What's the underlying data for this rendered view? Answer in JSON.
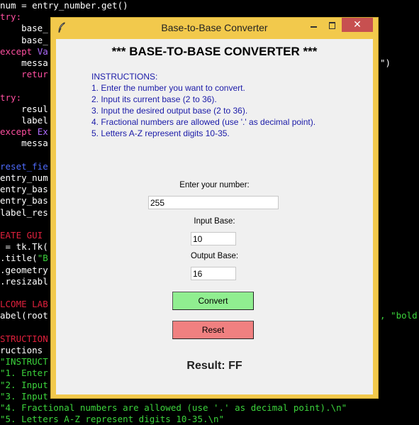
{
  "editor": {
    "lines": [
      {
        "segments": [
          {
            "text": "num = entry_number.get()",
            "color": "#ffffff"
          }
        ]
      },
      {
        "segments": [
          {
            "text": "try:",
            "color": "#ff4fa0"
          }
        ]
      },
      {
        "segments": [
          {
            "text": "    base_",
            "color": "#ffffff"
          }
        ]
      },
      {
        "segments": [
          {
            "text": "    base_",
            "color": "#ffffff"
          }
        ]
      },
      {
        "segments": [
          {
            "text": "except ",
            "color": "#ff4fa0"
          },
          {
            "text": "Va",
            "color": "#b06cff"
          }
        ]
      },
      {
        "segments": [
          {
            "text": "    messa",
            "color": "#ffffff"
          }
        ]
      },
      {
        "segments": [
          {
            "text": "    retur",
            "color": "#ff4fa0"
          }
        ]
      },
      {
        "segments": [
          {
            "text": "",
            "color": "#ffffff"
          }
        ]
      },
      {
        "segments": [
          {
            "text": "try:",
            "color": "#ff4fa0"
          }
        ]
      },
      {
        "segments": [
          {
            "text": "    resul",
            "color": "#ffffff"
          }
        ]
      },
      {
        "segments": [
          {
            "text": "    label",
            "color": "#ffffff"
          }
        ]
      },
      {
        "segments": [
          {
            "text": "except ",
            "color": "#ff4fa0"
          },
          {
            "text": "Ex",
            "color": "#b06cff"
          }
        ]
      },
      {
        "segments": [
          {
            "text": "    messa",
            "color": "#ffffff"
          }
        ]
      },
      {
        "segments": [
          {
            "text": "",
            "color": "#ffffff"
          }
        ]
      },
      {
        "segments": [
          {
            "text": "reset_fie",
            "color": "#4f6cff"
          }
        ]
      },
      {
        "segments": [
          {
            "text": "entry_num",
            "color": "#ffffff"
          }
        ]
      },
      {
        "segments": [
          {
            "text": "entry_bas",
            "color": "#ffffff"
          }
        ]
      },
      {
        "segments": [
          {
            "text": "entry_bas",
            "color": "#ffffff"
          }
        ]
      },
      {
        "segments": [
          {
            "text": "label_res",
            "color": "#ffffff"
          }
        ]
      },
      {
        "segments": [
          {
            "text": "",
            "color": "#ffffff"
          }
        ]
      },
      {
        "segments": [
          {
            "text": "EATE GUI",
            "color": "#e0203c"
          }
        ]
      },
      {
        "segments": [
          {
            "text": " = tk.Tk(",
            "color": "#ffffff"
          }
        ]
      },
      {
        "segments": [
          {
            "text": ".title(",
            "color": "#ffffff"
          },
          {
            "text": "\"B",
            "color": "#3cd43c"
          }
        ]
      },
      {
        "segments": [
          {
            "text": ".geometry",
            "color": "#ffffff"
          }
        ]
      },
      {
        "segments": [
          {
            "text": ".resizabl",
            "color": "#ffffff"
          }
        ]
      },
      {
        "segments": [
          {
            "text": "",
            "color": "#ffffff"
          }
        ]
      },
      {
        "segments": [
          {
            "text": "LCOME LAB",
            "color": "#e0203c"
          }
        ]
      },
      {
        "segments": [
          {
            "text": "abel(root",
            "color": "#ffffff"
          }
        ]
      },
      {
        "segments": [
          {
            "text": "",
            "color": "#ffffff"
          }
        ]
      },
      {
        "segments": [
          {
            "text": "STRUCTION",
            "color": "#e0203c"
          }
        ]
      },
      {
        "segments": [
          {
            "text": "ructions",
            "color": "#ffffff"
          }
        ]
      },
      {
        "segments": [
          {
            "text": "\"INSTRUCT",
            "color": "#3cd43c"
          }
        ]
      },
      {
        "segments": [
          {
            "text": "\"1. Enter",
            "color": "#3cd43c"
          }
        ]
      },
      {
        "segments": [
          {
            "text": "\"2. Input",
            "color": "#3cd43c"
          }
        ]
      },
      {
        "segments": [
          {
            "text": "\"3. Input",
            "color": "#3cd43c"
          }
        ]
      },
      {
        "segments": [
          {
            "text": "\"4. Fractional numbers are allowed (use '.' as decimal point).\\n\"",
            "color": "#3cd43c"
          }
        ]
      },
      {
        "segments": [
          {
            "text": "\"5. Letters A-Z represent digits 10-35.\\n\"",
            "color": "#3cd43c"
          }
        ]
      }
    ],
    "right_fragments": [
      {
        "line": 5,
        "text": "\")",
        "color": "#ffffff"
      },
      {
        "line": 27,
        "text": ", \"bold",
        "color": "#3cd43c"
      }
    ]
  },
  "window": {
    "title": "Base-to-Base Converter",
    "close_glyph": "✕"
  },
  "app": {
    "heading": "*** BASE-TO-BASE CONVERTER ***",
    "instructions": [
      "INSTRUCTIONS:",
      "1. Enter the number you want to convert.",
      "2. Input its current base (2 to 36).",
      "3. Input the desired output base (2 to 36).",
      "4. Fractional numbers are allowed (use '.' as decimal point).",
      "5. Letters A-Z represent digits 10-35."
    ],
    "number_label": "Enter your number:",
    "number_value": "255",
    "input_base_label": "Input Base:",
    "input_base_value": "10",
    "output_base_label": "Output Base:",
    "output_base_value": "16",
    "convert_label": "Convert",
    "reset_label": "Reset",
    "result_text": "Result: FF"
  },
  "colors": {
    "window_frame": "#f2c94c",
    "convert_button": "#90ee90",
    "reset_button": "#f08080",
    "close_button": "#c75050",
    "instructions_text": "#1a1aa8"
  }
}
